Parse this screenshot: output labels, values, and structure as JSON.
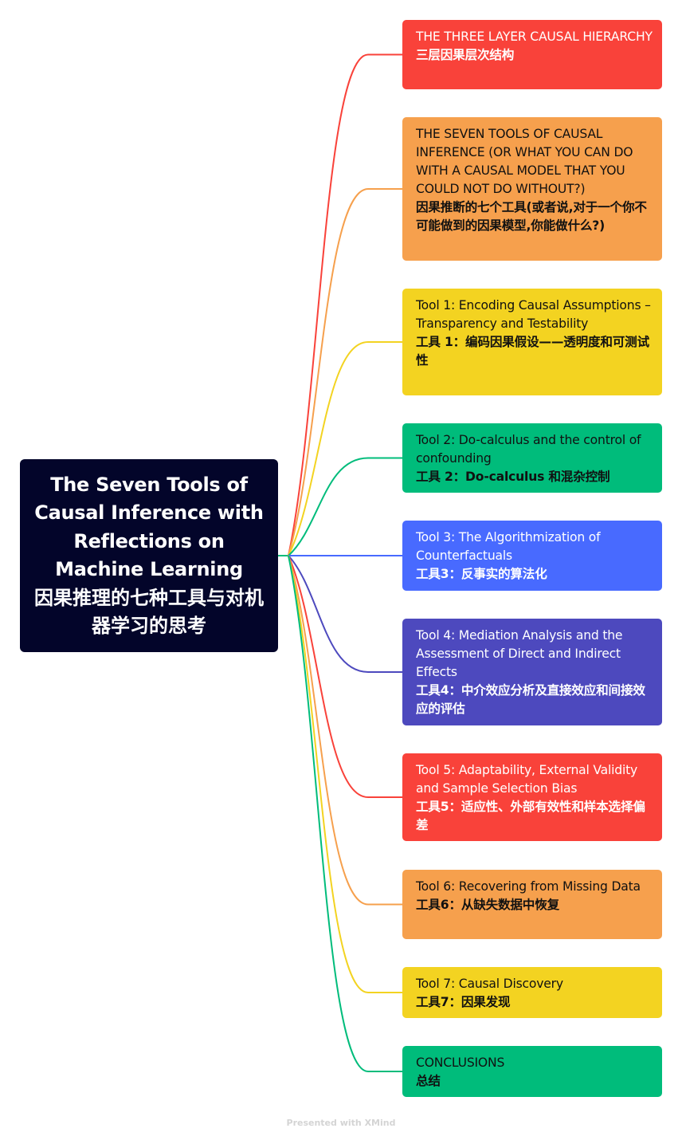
{
  "root": {
    "title_en": "The Seven Tools of Causal Inference with Reflections on Machine Learning",
    "title_zh": "因果推理的七种工具与对机器学习的思考",
    "color": "#03052a"
  },
  "branches": [
    {
      "en": "THE THREE LAYER CAUSAL HIERARCHY",
      "zh": "三层因果层次结构",
      "color": "#f9423a",
      "text_color": "#ffffff"
    },
    {
      "en": "THE SEVEN TOOLS OF CAUSAL INFERENCE (OR WHAT YOU CAN DO WITH A CAUSAL MODEL THAT YOU COULD NOT DO WITHOUT?)",
      "zh": "因果推断的七个工具(或者说,对于一个你不可能做到的因果模型,你能做什么?)",
      "color": "#f6a04d",
      "text_color": "#111111"
    },
    {
      "en": "Tool 1: Encoding Causal Assumptions – Transparency and Testability",
      "zh": "工具 1：编码因果假设——透明度和可测试性",
      "color": "#f3d321",
      "text_color": "#111111"
    },
    {
      "en": "Tool 2: Do-calculus and the control of confounding",
      "zh": "工具 2：Do-calculus 和混杂控制",
      "color": "#00bc7b",
      "text_color": "#111111"
    },
    {
      "en": "Tool 3: The Algorithmization of Counterfactuals",
      "zh": "工具3：反事实的算法化",
      "color": "#486aff",
      "text_color": "#ffffff"
    },
    {
      "en": "Tool 4: Mediation Analysis and the Assessment of Direct and Indirect Effects",
      "zh": "工具4：中介效应分析及直接效应和间接效应的评估",
      "color": "#4d49be",
      "text_color": "#ffffff"
    },
    {
      "en": "Tool 5: Adaptability, External Validity and Sample Selection Bias",
      "zh": "工具5：适应性、外部有效性和样本选择偏差",
      "color": "#f9423a",
      "text_color": "#ffffff"
    },
    {
      "en": "Tool 6: Recovering from Missing Data",
      "zh": "工具6：从缺失数据中恢复",
      "color": "#f6a04d",
      "text_color": "#111111"
    },
    {
      "en": "Tool 7: Causal Discovery",
      "zh": "工具7：因果发现",
      "color": "#f3d321",
      "text_color": "#111111"
    },
    {
      "en": "CONCLUSIONS",
      "zh": "总结",
      "color": "#00bc7b",
      "text_color": "#111111"
    }
  ],
  "footer": "Presented with XMind"
}
